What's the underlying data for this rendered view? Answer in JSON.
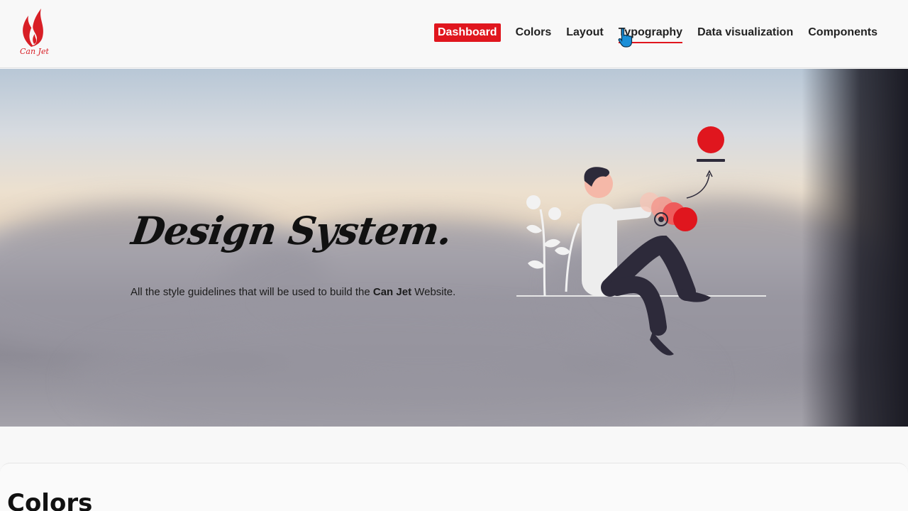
{
  "brand": {
    "logo_text": "Can Jet",
    "accent_color": "#e0161e"
  },
  "nav": {
    "items": [
      {
        "label": "Dashboard",
        "state": "active"
      },
      {
        "label": "Colors",
        "state": "normal"
      },
      {
        "label": "Layout",
        "state": "normal"
      },
      {
        "label": "Typography",
        "state": "hover"
      },
      {
        "label": "Data visualization",
        "state": "normal"
      },
      {
        "label": "Components",
        "state": "normal"
      }
    ]
  },
  "hero": {
    "title": "Design System.",
    "subtitle_prefix": "All the style guidelines that will be used to build the ",
    "subtitle_bold": "Can Jet",
    "subtitle_suffix": " Website.",
    "illustration_icon": "person-picking-colors-illustration"
  },
  "section": {
    "title": "Colors"
  },
  "cursor": {
    "icon": "hand-pointer-icon"
  }
}
